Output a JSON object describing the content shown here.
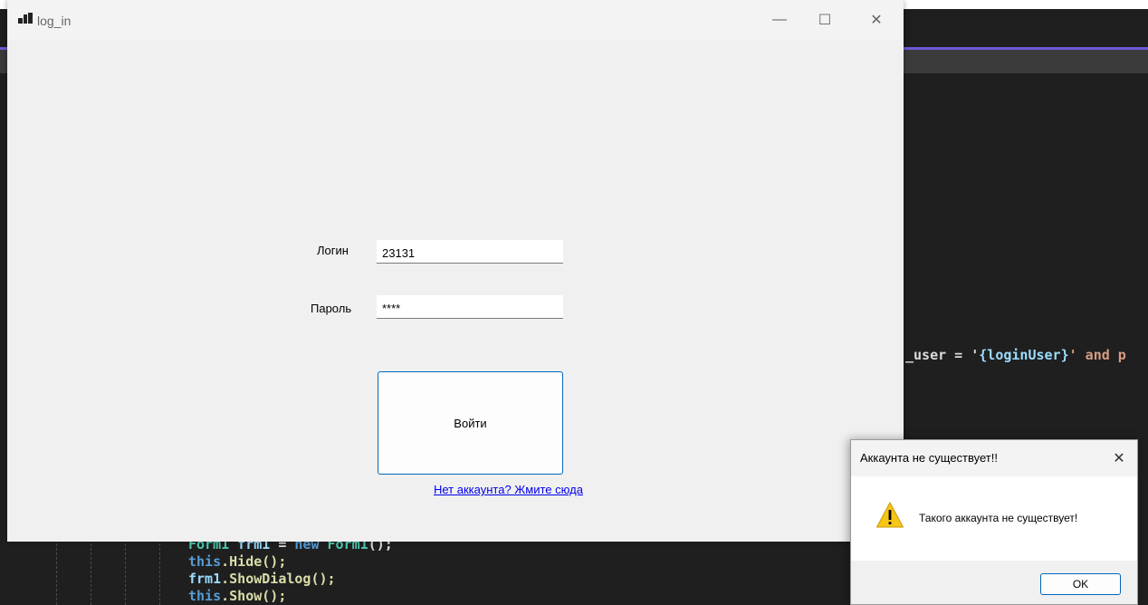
{
  "login_window": {
    "title": "log_in",
    "caption_minimize": "—",
    "caption_maximize": "☐",
    "caption_close": "✕",
    "login_label": "Логин",
    "login_value": "23131",
    "password_label": "Пароль",
    "password_value": "****",
    "login_button": "Войти",
    "register_link": "Нет аккаунта? Жмите сюда"
  },
  "message_box": {
    "title": "Аккаунта не существует!!",
    "close_glyph": "✕",
    "message": "Такого аккаунта не существует!",
    "icon": "warning-icon",
    "ok_button": "OK"
  },
  "editor": {
    "line_sql_user": "_user = '",
    "line_sql_var": "{loginUser}",
    "line_sql_tail": "' and p",
    "line1_type": "Form1",
    "line1_var": " frm1 ",
    "line1_op": "= ",
    "line1_kw": "new ",
    "line1_type2": "Form1",
    "line1_end": "();",
    "line2_kw": "this",
    "line2_rest": ".Hide();",
    "line3_var": "frm1",
    "line3_rest": ".ShowDialog();",
    "line4_kw": "this",
    "line4_rest": ".Show();"
  },
  "colors": {
    "accent": "#0067c0",
    "link": "#0000ee",
    "editor_bg": "#1f1f1f",
    "editor_accent": "#6f58d8",
    "warning": "#f5c518"
  }
}
